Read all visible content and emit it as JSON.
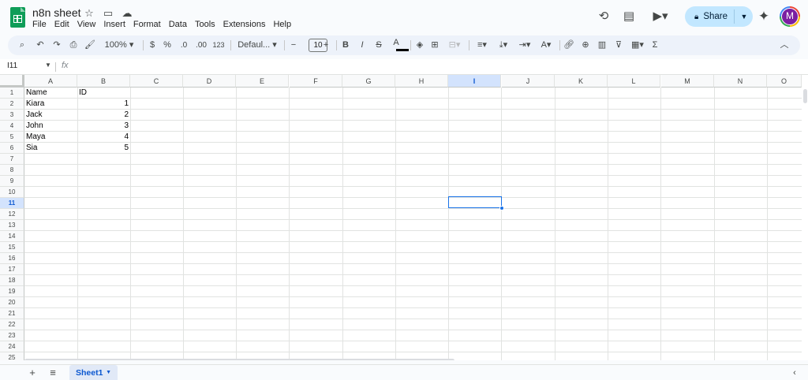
{
  "doc": {
    "title": "n8n sheet"
  },
  "menu": [
    "File",
    "Edit",
    "View",
    "Insert",
    "Format",
    "Data",
    "Tools",
    "Extensions",
    "Help"
  ],
  "share": {
    "label": "Share"
  },
  "avatar": {
    "initial": "M"
  },
  "toolbar": {
    "zoom": "100%",
    "currency": "$",
    "percent": "%",
    "dec_decrease": ".0",
    "dec_increase": ".00",
    "num_format": "123",
    "font": "Defaul...",
    "font_size": "10",
    "bold": "B",
    "italic": "I",
    "strike": "S",
    "text_color": "A",
    "sum": "Σ"
  },
  "formula_bar": {
    "name_box": "I11",
    "fx": "fx"
  },
  "columns": [
    "A",
    "B",
    "C",
    "D",
    "E",
    "F",
    "G",
    "H",
    "I",
    "J",
    "K",
    "L",
    "M",
    "N",
    "O"
  ],
  "selected_column": "I",
  "rows": [
    "1",
    "2",
    "3",
    "4",
    "5",
    "6",
    "7",
    "8",
    "9",
    "10",
    "11",
    "12",
    "13",
    "14",
    "15",
    "16",
    "17",
    "18",
    "19",
    "20",
    "21",
    "22",
    "23",
    "24",
    "25"
  ],
  "selected_row": "11",
  "cells": {
    "A1": "Name",
    "B1": "ID",
    "A2": "Kiara",
    "B2": "1",
    "A3": "Jack",
    "B3": "2",
    "A4": "John",
    "B4": "3",
    "A5": "Maya",
    "B5": "4",
    "A6": "Sia",
    "B6": "5"
  },
  "sheets": [
    {
      "name": "Sheet1",
      "active": true
    }
  ]
}
